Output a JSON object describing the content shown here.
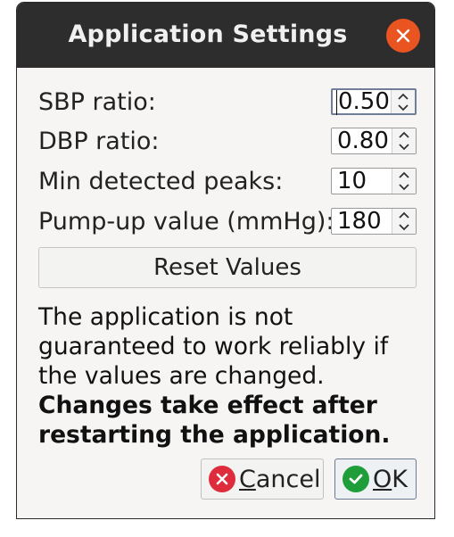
{
  "window": {
    "title": "Application Settings"
  },
  "settings": [
    {
      "label": "SBP ratio:",
      "value": "0.50",
      "focused": true
    },
    {
      "label": "DBP ratio:",
      "value": "0.80",
      "focused": false
    },
    {
      "label": "Min detected peaks:",
      "value": "10",
      "focused": false
    },
    {
      "label": "Pump-up value (mmHg):",
      "value": "180",
      "focused": false
    }
  ],
  "reset_label": "Reset Values",
  "info": {
    "normal": "The application is not guaranteed to work reliably if the values are changed.",
    "bold": "Changes take effect after restarting the application."
  },
  "buttons": {
    "cancel": {
      "mnemonic": "C",
      "rest": "ancel",
      "icon": "cancel-icon"
    },
    "ok": {
      "mnemonic": "O",
      "rest": "K",
      "icon": "ok-check-icon"
    }
  },
  "colors": {
    "titlebar": "#2d2d2d",
    "close": "#e95420",
    "cancel_icon": "#df2c3c",
    "ok_icon": "#1f9d3a"
  }
}
